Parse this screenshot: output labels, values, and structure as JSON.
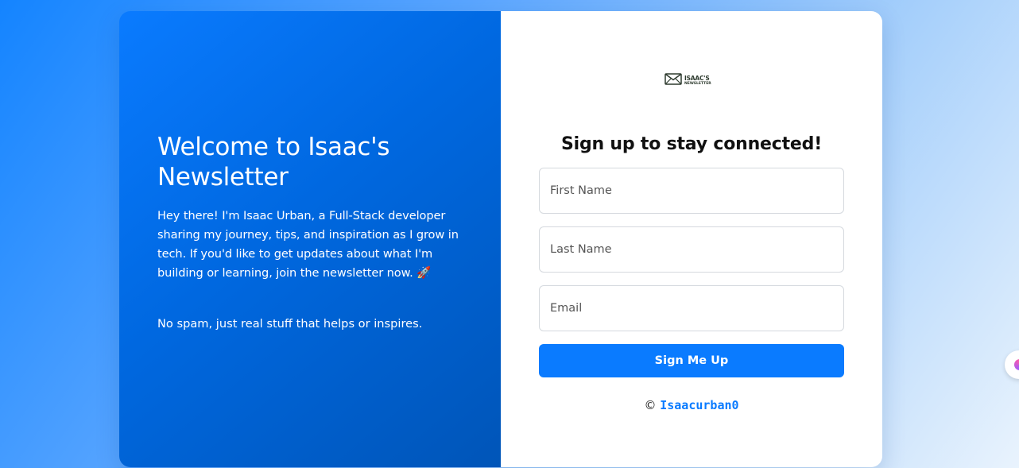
{
  "welcome": {
    "title": "Welcome to Isaac's Newsletter",
    "intro": "Hey there! I'm Isaac Urban, a Full-Stack developer sharing my journey, tips, and inspiration as I grow in tech. If you'd like to get updates about what I'm building or learning, join the newsletter now. 🚀",
    "nospam": "No spam, just real stuff that helps or inspires."
  },
  "logo": {
    "icon": "envelope-icon",
    "line1": "ISAAC'S",
    "line2": "NEWSLETTER"
  },
  "form": {
    "title": "Sign up to stay connected!",
    "first_name_placeholder": "First Name",
    "last_name_placeholder": "Last Name",
    "email_placeholder": "Email",
    "submit_label": "Sign Me Up"
  },
  "footer": {
    "copyright": "©",
    "author": "Isaacurban0"
  },
  "colors": {
    "accent": "#0a7bff",
    "left_panel_start": "#0a7bff",
    "left_panel_end": "#0055b8"
  },
  "edge_widget": {
    "icon": "extension-orb-icon"
  }
}
